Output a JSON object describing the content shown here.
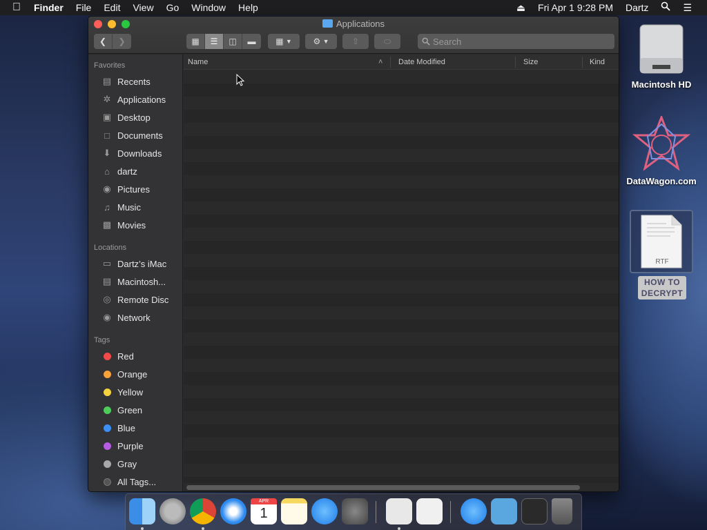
{
  "menubar": {
    "app_name": "Finder",
    "menus": [
      "File",
      "Edit",
      "View",
      "Go",
      "Window",
      "Help"
    ],
    "datetime": "Fri Apr 1  9:28 PM",
    "user": "Dartz"
  },
  "window": {
    "title": "Applications",
    "search_placeholder": "Search"
  },
  "sidebar": {
    "favorites_header": "Favorites",
    "favorites": [
      {
        "label": "Recents",
        "icon": "recents-icon"
      },
      {
        "label": "Applications",
        "icon": "applications-icon"
      },
      {
        "label": "Desktop",
        "icon": "desktop-icon"
      },
      {
        "label": "Documents",
        "icon": "documents-icon"
      },
      {
        "label": "Downloads",
        "icon": "downloads-icon"
      },
      {
        "label": "dartz",
        "icon": "home-icon"
      },
      {
        "label": "Pictures",
        "icon": "camera-icon"
      },
      {
        "label": "Music",
        "icon": "music-note-icon"
      },
      {
        "label": "Movies",
        "icon": "film-icon"
      }
    ],
    "locations_header": "Locations",
    "locations": [
      {
        "label": "Dartz’s iMac",
        "icon": "imac-icon"
      },
      {
        "label": "Macintosh...",
        "icon": "disk-icon"
      },
      {
        "label": "Remote Disc",
        "icon": "cd-icon"
      },
      {
        "label": "Network",
        "icon": "network-globe-icon"
      }
    ],
    "tags_header": "Tags",
    "tags": [
      {
        "label": "Red",
        "color": "#f2494a"
      },
      {
        "label": "Orange",
        "color": "#f7a13a"
      },
      {
        "label": "Yellow",
        "color": "#f5d33f"
      },
      {
        "label": "Green",
        "color": "#4fcd5a"
      },
      {
        "label": "Blue",
        "color": "#3b8ff5"
      },
      {
        "label": "Purple",
        "color": "#b65ce0"
      },
      {
        "label": "Gray",
        "color": "#a8a8a8"
      },
      {
        "label": "All Tags...",
        "color": "#555555"
      }
    ]
  },
  "columns": {
    "name": "Name",
    "date_modified": "Date Modified",
    "size": "Size",
    "kind": "Kind"
  },
  "desktop": {
    "icons": [
      {
        "label": "Macintosh HD"
      },
      {
        "label": "DataWagon.com"
      },
      {
        "label": "HOW TO DECRYPT",
        "badge": "RTF"
      }
    ]
  },
  "dock": {
    "apps": [
      "finder-icon",
      "launchpad-icon",
      "chrome-icon",
      "safari-icon",
      "calendar-icon",
      "notes-icon",
      "app-store-icon",
      "system-preferences-icon",
      "document-icon",
      "textedit-icon",
      "app-store-folder-icon",
      "downloads-folder-icon",
      "screen-recording-icon",
      "trash-icon"
    ],
    "calendar_month": "APR",
    "calendar_day": "1"
  }
}
